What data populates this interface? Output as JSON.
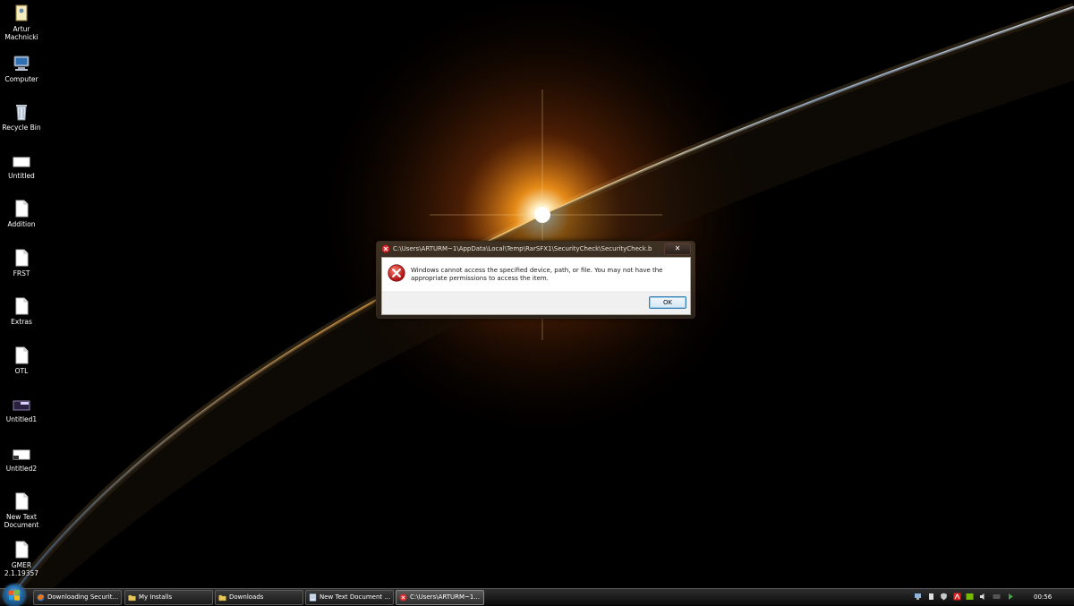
{
  "desktop": {
    "icons": [
      {
        "label": "Artur\nMachnicki",
        "icon": "user-folder-icon"
      },
      {
        "label": "Computer",
        "icon": "computer-icon"
      },
      {
        "label": "Recycle Bin",
        "icon": "recycle-bin-icon"
      },
      {
        "label": "Untitled",
        "icon": "image-file-icon"
      },
      {
        "label": "Addition",
        "icon": "text-file-icon"
      },
      {
        "label": "FRST",
        "icon": "text-file-icon"
      },
      {
        "label": "Extras",
        "icon": "text-file-icon"
      },
      {
        "label": "OTL",
        "icon": "text-file-icon"
      },
      {
        "label": "Untitled1",
        "icon": "image-file-icon"
      },
      {
        "label": "Untitled2",
        "icon": "image-file-icon"
      },
      {
        "label": "New Text\nDocument",
        "icon": "text-file-icon"
      },
      {
        "label": "GMER\n2.1.19357",
        "icon": "text-file-icon"
      }
    ]
  },
  "dialog": {
    "title": "C:\\Users\\ARTURM~1\\AppData\\Local\\Temp\\RarSFX1\\SecurityCheck\\SecurityCheck.bat",
    "close_label": "✕",
    "message": "Windows cannot access the specified device, path, or file.  You may not have the appropriate permissions to access the item.",
    "ok_label": "OK",
    "icon": "error-icon"
  },
  "taskbar": {
    "buttons": [
      {
        "label": "Downloading Securit...",
        "icon": "firefox-icon"
      },
      {
        "label": "My Installs",
        "icon": "folder-icon"
      },
      {
        "label": "Downloads",
        "icon": "folder-icon"
      },
      {
        "label": "New Text Document ...",
        "icon": "notepad-icon"
      },
      {
        "label": "C:\\Users\\ARTURM~1...",
        "icon": "error-icon"
      }
    ],
    "clock": "00:56"
  },
  "colors": {
    "accent_error": "#d9282a",
    "taskbar": "#1a1a1a",
    "dialog_frame": "#3e3224"
  }
}
